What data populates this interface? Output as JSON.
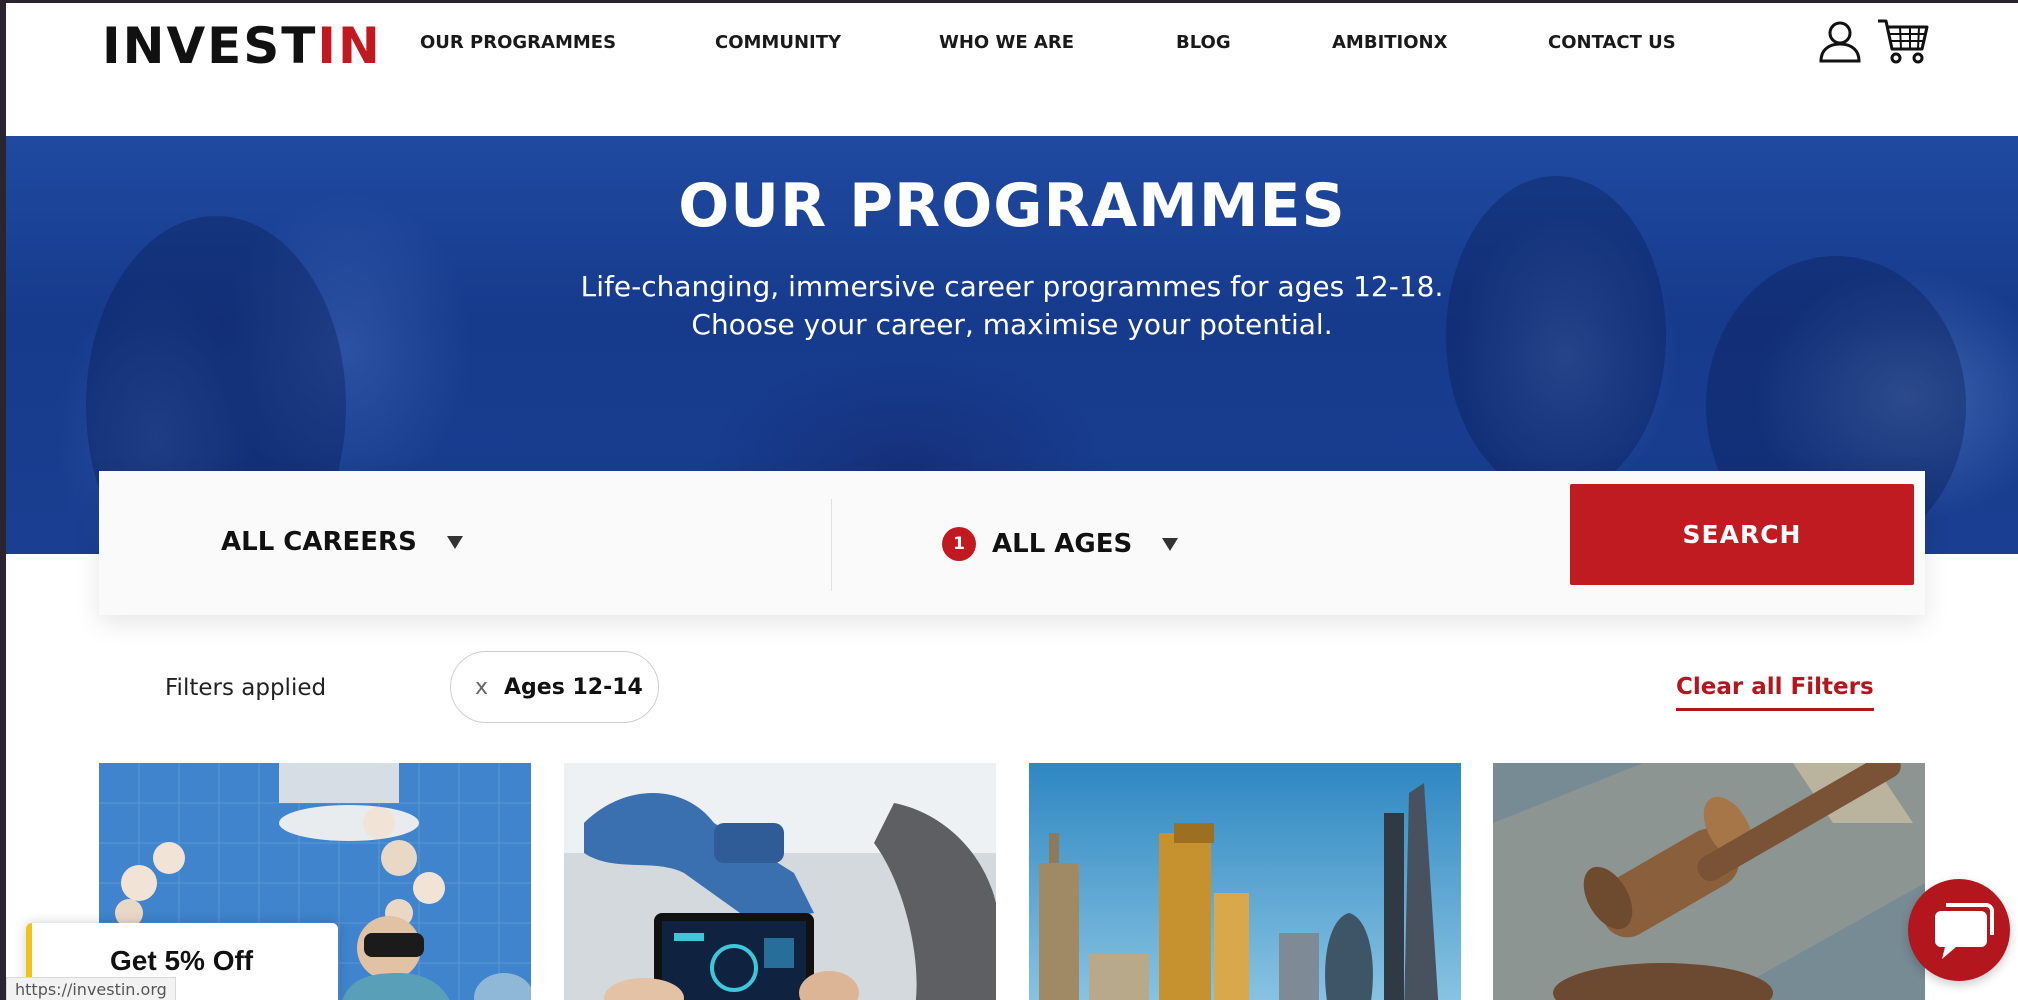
{
  "brand": {
    "logo_black": "INVEST",
    "logo_red": "IN"
  },
  "nav": {
    "items": [
      {
        "label": "OUR PROGRAMMES"
      },
      {
        "label": "COMMUNITY"
      },
      {
        "label": "WHO WE ARE"
      },
      {
        "label": "BLOG"
      },
      {
        "label": "AMBITIONX"
      },
      {
        "label": "CONTACT US"
      }
    ],
    "icons": [
      "user-icon",
      "cart-icon"
    ]
  },
  "hero": {
    "title": "OUR PROGRAMMES",
    "subtitle_line1": "Life-changing, immersive career programmes for ages 12-18.",
    "subtitle_line2": "Choose your career, maximise your potential."
  },
  "filters": {
    "careers_label": "ALL CAREERS",
    "ages_label": "ALL AGES",
    "ages_badge": "1",
    "search_label": "SEARCH",
    "applied_label": "Filters applied",
    "chip_remove": "x",
    "chip_label": "Ages 12-14",
    "clear_label": "Clear all Filters"
  },
  "cards": [
    {
      "image": "surgeon-vr-operating-theatre"
    },
    {
      "image": "robotic-arm-tablet"
    },
    {
      "image": "london-skyline"
    },
    {
      "image": "judge-gavel"
    }
  ],
  "promo": {
    "label": "Get 5% Off"
  },
  "status_bar": {
    "url": "https://investin.org"
  },
  "colors": {
    "brand_red": "#c0191f",
    "hero_blue": "#1f4aa0",
    "promo_yellow": "#f2c21b"
  }
}
